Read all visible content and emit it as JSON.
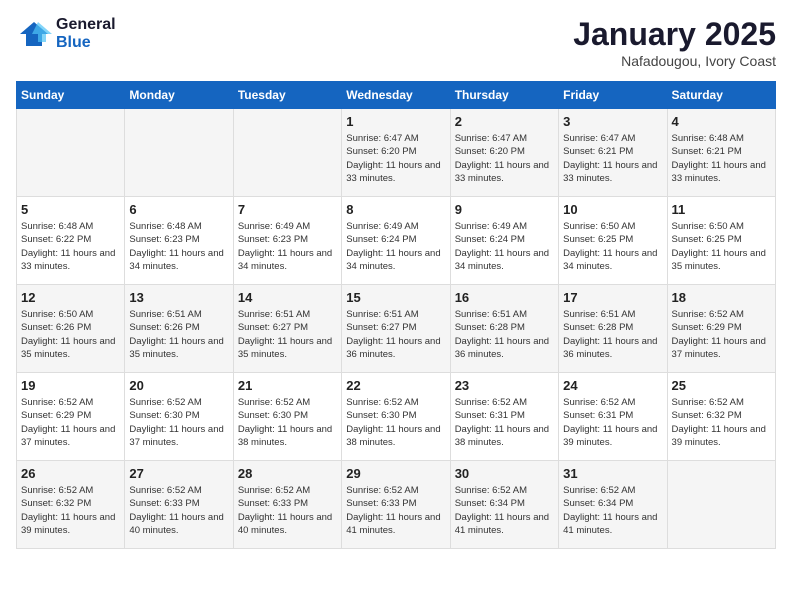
{
  "header": {
    "logo_line1": "General",
    "logo_line2": "Blue",
    "month": "January 2025",
    "location": "Nafadougou, Ivory Coast"
  },
  "days_of_week": [
    "Sunday",
    "Monday",
    "Tuesday",
    "Wednesday",
    "Thursday",
    "Friday",
    "Saturday"
  ],
  "weeks": [
    [
      {
        "num": "",
        "info": ""
      },
      {
        "num": "",
        "info": ""
      },
      {
        "num": "",
        "info": ""
      },
      {
        "num": "1",
        "info": "Sunrise: 6:47 AM\nSunset: 6:20 PM\nDaylight: 11 hours\nand 33 minutes."
      },
      {
        "num": "2",
        "info": "Sunrise: 6:47 AM\nSunset: 6:20 PM\nDaylight: 11 hours\nand 33 minutes."
      },
      {
        "num": "3",
        "info": "Sunrise: 6:47 AM\nSunset: 6:21 PM\nDaylight: 11 hours\nand 33 minutes."
      },
      {
        "num": "4",
        "info": "Sunrise: 6:48 AM\nSunset: 6:21 PM\nDaylight: 11 hours\nand 33 minutes."
      }
    ],
    [
      {
        "num": "5",
        "info": "Sunrise: 6:48 AM\nSunset: 6:22 PM\nDaylight: 11 hours\nand 33 minutes."
      },
      {
        "num": "6",
        "info": "Sunrise: 6:48 AM\nSunset: 6:23 PM\nDaylight: 11 hours\nand 34 minutes."
      },
      {
        "num": "7",
        "info": "Sunrise: 6:49 AM\nSunset: 6:23 PM\nDaylight: 11 hours\nand 34 minutes."
      },
      {
        "num": "8",
        "info": "Sunrise: 6:49 AM\nSunset: 6:24 PM\nDaylight: 11 hours\nand 34 minutes."
      },
      {
        "num": "9",
        "info": "Sunrise: 6:49 AM\nSunset: 6:24 PM\nDaylight: 11 hours\nand 34 minutes."
      },
      {
        "num": "10",
        "info": "Sunrise: 6:50 AM\nSunset: 6:25 PM\nDaylight: 11 hours\nand 34 minutes."
      },
      {
        "num": "11",
        "info": "Sunrise: 6:50 AM\nSunset: 6:25 PM\nDaylight: 11 hours\nand 35 minutes."
      }
    ],
    [
      {
        "num": "12",
        "info": "Sunrise: 6:50 AM\nSunset: 6:26 PM\nDaylight: 11 hours\nand 35 minutes."
      },
      {
        "num": "13",
        "info": "Sunrise: 6:51 AM\nSunset: 6:26 PM\nDaylight: 11 hours\nand 35 minutes."
      },
      {
        "num": "14",
        "info": "Sunrise: 6:51 AM\nSunset: 6:27 PM\nDaylight: 11 hours\nand 35 minutes."
      },
      {
        "num": "15",
        "info": "Sunrise: 6:51 AM\nSunset: 6:27 PM\nDaylight: 11 hours\nand 36 minutes."
      },
      {
        "num": "16",
        "info": "Sunrise: 6:51 AM\nSunset: 6:28 PM\nDaylight: 11 hours\nand 36 minutes."
      },
      {
        "num": "17",
        "info": "Sunrise: 6:51 AM\nSunset: 6:28 PM\nDaylight: 11 hours\nand 36 minutes."
      },
      {
        "num": "18",
        "info": "Sunrise: 6:52 AM\nSunset: 6:29 PM\nDaylight: 11 hours\nand 37 minutes."
      }
    ],
    [
      {
        "num": "19",
        "info": "Sunrise: 6:52 AM\nSunset: 6:29 PM\nDaylight: 11 hours\nand 37 minutes."
      },
      {
        "num": "20",
        "info": "Sunrise: 6:52 AM\nSunset: 6:30 PM\nDaylight: 11 hours\nand 37 minutes."
      },
      {
        "num": "21",
        "info": "Sunrise: 6:52 AM\nSunset: 6:30 PM\nDaylight: 11 hours\nand 38 minutes."
      },
      {
        "num": "22",
        "info": "Sunrise: 6:52 AM\nSunset: 6:30 PM\nDaylight: 11 hours\nand 38 minutes."
      },
      {
        "num": "23",
        "info": "Sunrise: 6:52 AM\nSunset: 6:31 PM\nDaylight: 11 hours\nand 38 minutes."
      },
      {
        "num": "24",
        "info": "Sunrise: 6:52 AM\nSunset: 6:31 PM\nDaylight: 11 hours\nand 39 minutes."
      },
      {
        "num": "25",
        "info": "Sunrise: 6:52 AM\nSunset: 6:32 PM\nDaylight: 11 hours\nand 39 minutes."
      }
    ],
    [
      {
        "num": "26",
        "info": "Sunrise: 6:52 AM\nSunset: 6:32 PM\nDaylight: 11 hours\nand 39 minutes."
      },
      {
        "num": "27",
        "info": "Sunrise: 6:52 AM\nSunset: 6:33 PM\nDaylight: 11 hours\nand 40 minutes."
      },
      {
        "num": "28",
        "info": "Sunrise: 6:52 AM\nSunset: 6:33 PM\nDaylight: 11 hours\nand 40 minutes."
      },
      {
        "num": "29",
        "info": "Sunrise: 6:52 AM\nSunset: 6:33 PM\nDaylight: 11 hours\nand 41 minutes."
      },
      {
        "num": "30",
        "info": "Sunrise: 6:52 AM\nSunset: 6:34 PM\nDaylight: 11 hours\nand 41 minutes."
      },
      {
        "num": "31",
        "info": "Sunrise: 6:52 AM\nSunset: 6:34 PM\nDaylight: 11 hours\nand 41 minutes."
      },
      {
        "num": "",
        "info": ""
      }
    ]
  ]
}
